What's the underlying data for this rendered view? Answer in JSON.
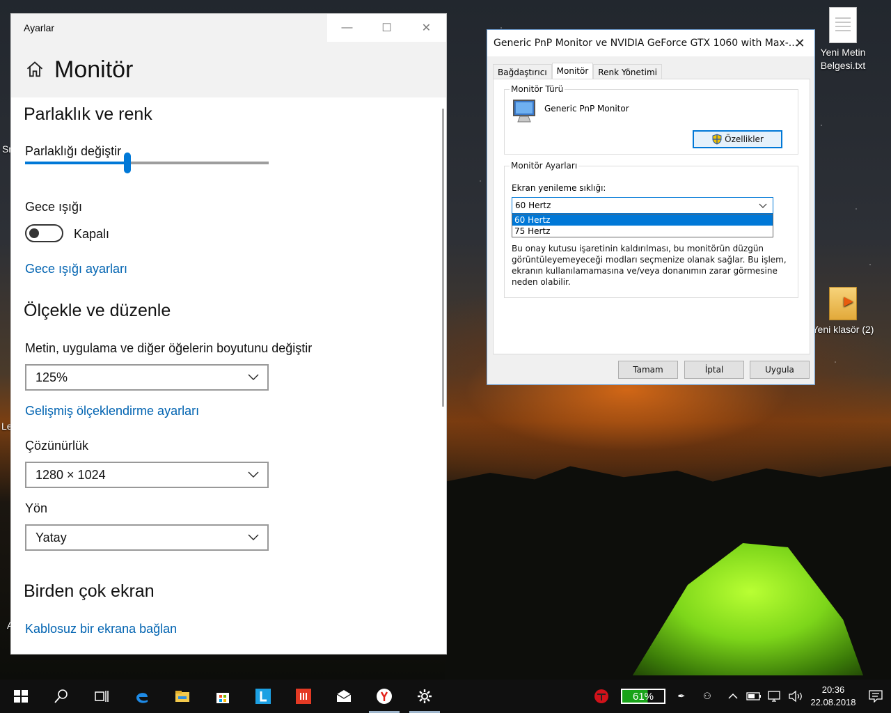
{
  "desktop": {
    "icons": [
      {
        "label": "Yeni Metin Belgesi.txt"
      },
      {
        "label": "Yeni klasör (2)"
      }
    ],
    "edge_fragments": [
      "Sn",
      "Le",
      "A"
    ]
  },
  "settings": {
    "window_title": "Ayarlar",
    "page_title": "Monitör",
    "brightness_section": "Parlaklık ve renk",
    "brightness_label": "Parlaklığı değiştir",
    "brightness_level": 0.42,
    "night_light_label": "Gece ışığı",
    "night_light_state": "Kapalı",
    "night_light_settings_link": "Gece ışığı ayarları",
    "scale_section": "Ölçekle ve düzenle",
    "scale_label": "Metin, uygulama ve diğer öğelerin boyutunu değiştir",
    "scale_value": "125%",
    "advanced_scaling_link": "Gelişmiş ölçeklendirme ayarları",
    "resolution_label": "Çözünürlük",
    "resolution_value": "1280 × 1024",
    "orientation_label": "Yön",
    "orientation_value": "Yatay",
    "multi_display_section": "Birden çok ekran",
    "wireless_link": "Kablosuz bir ekrana bağlan"
  },
  "dialog": {
    "title": "Generic PnP Monitor ve NVIDIA GeForce GTX 1060 with Max-...",
    "tabs": [
      {
        "label": "Bağdaştırıcı"
      },
      {
        "label": "Monitör"
      },
      {
        "label": "Renk Yönetimi"
      }
    ],
    "monitor_type_group": "Monitör Türü",
    "monitor_name": "Generic PnP Monitor",
    "properties_button": "Özellikler",
    "monitor_settings_group": "Monitör Ayarları",
    "refresh_label": "Ekran yenileme sıklığı:",
    "refresh_value": "60 Hertz",
    "refresh_options": [
      "60 Hertz",
      "75 Hertz"
    ],
    "warning_text": "Bu onay kutusu işaretinin kaldırılması, bu monitörün düzgün görüntüleyemeyeceği modları seçmenize olanak sağlar. Bu işlem, ekranın kullanılamamasına ve/veya donanımın zarar görmesine neden olabilir.",
    "ok_button": "Tamam",
    "cancel_button": "İptal",
    "apply_button": "Uygula"
  },
  "taskbar": {
    "battery_percent": "61%",
    "time": "20:36",
    "date": "22.08.2018"
  },
  "colors": {
    "accent": "#0078d7",
    "link": "#0063b1",
    "taskbar": "#101010",
    "battery_fill": "#19a319"
  }
}
